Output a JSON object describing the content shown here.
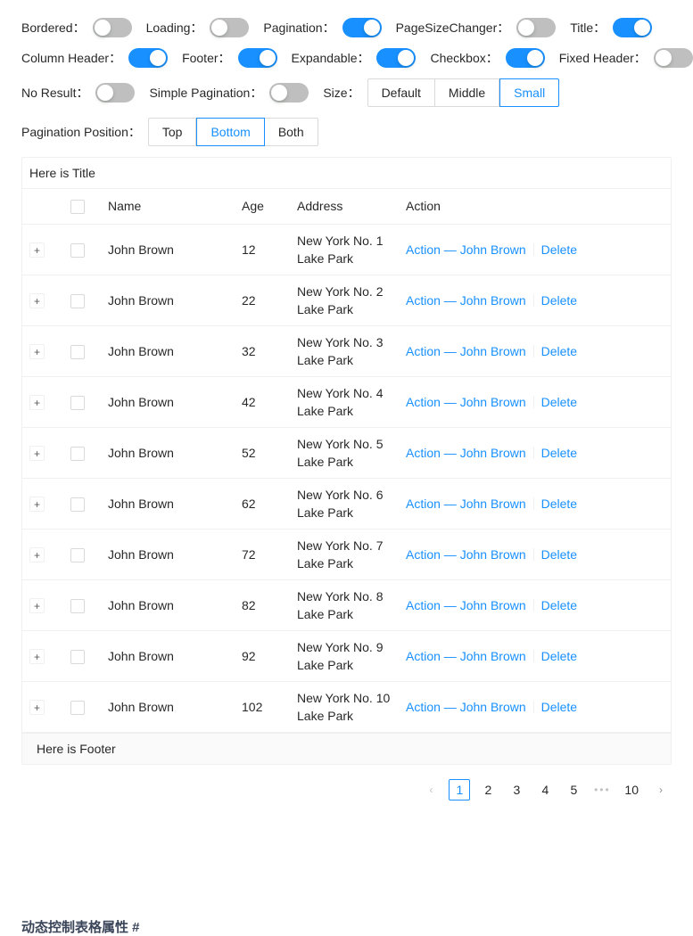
{
  "controls": {
    "rows": [
      [
        {
          "label": "Bordered",
          "type": "switch",
          "on": false,
          "name": "bordered"
        },
        {
          "label": "Loading",
          "type": "switch",
          "on": false,
          "name": "loading"
        },
        {
          "label": "Pagination",
          "type": "switch",
          "on": true,
          "name": "pagination"
        },
        {
          "label": "PageSizeChanger",
          "type": "switch",
          "on": false,
          "name": "page-size-changer"
        },
        {
          "label": "Title",
          "type": "switch",
          "on": true,
          "name": "title"
        }
      ],
      [
        {
          "label": "Column Header",
          "type": "switch",
          "on": true,
          "name": "column-header"
        },
        {
          "label": "Footer",
          "type": "switch",
          "on": true,
          "name": "footer"
        },
        {
          "label": "Expandable",
          "type": "switch",
          "on": true,
          "name": "expandable"
        },
        {
          "label": "Checkbox",
          "type": "switch",
          "on": true,
          "name": "checkbox"
        },
        {
          "label": "Fixed Header",
          "type": "switch",
          "on": false,
          "name": "fixed-header"
        }
      ],
      [
        {
          "label": "No Result",
          "type": "switch",
          "on": false,
          "name": "no-result"
        },
        {
          "label": "Simple Pagination",
          "type": "switch",
          "on": false,
          "name": "simple-pagination"
        },
        {
          "label": "Size",
          "type": "group",
          "name": "size",
          "options": [
            "Default",
            "Middle",
            "Small"
          ],
          "selected": "Small"
        }
      ],
      [
        {
          "label": "Pagination Position",
          "type": "group",
          "name": "pagination-position",
          "options": [
            "Top",
            "Bottom",
            "Both"
          ],
          "selected": "Bottom"
        }
      ]
    ],
    "colon": "："
  },
  "table": {
    "title": "Here is Title",
    "footer": "Here is Footer",
    "columns": [
      "Name",
      "Age",
      "Address",
      "Action"
    ],
    "expand_glyph": "+",
    "action_primary": "Action — John Brown",
    "action_delete": "Delete",
    "rows": [
      {
        "name": "John Brown",
        "age": "12",
        "address": "New York No. 1 Lake Park"
      },
      {
        "name": "John Brown",
        "age": "22",
        "address": "New York No. 2 Lake Park"
      },
      {
        "name": "John Brown",
        "age": "32",
        "address": "New York No. 3 Lake Park"
      },
      {
        "name": "John Brown",
        "age": "42",
        "address": "New York No. 4 Lake Park"
      },
      {
        "name": "John Brown",
        "age": "52",
        "address": "New York No. 5 Lake Park"
      },
      {
        "name": "John Brown",
        "age": "62",
        "address": "New York No. 6 Lake Park"
      },
      {
        "name": "John Brown",
        "age": "72",
        "address": "New York No. 7 Lake Park"
      },
      {
        "name": "John Brown",
        "age": "82",
        "address": "New York No. 8 Lake Park"
      },
      {
        "name": "John Brown",
        "age": "92",
        "address": "New York No. 9 Lake Park"
      },
      {
        "name": "John Brown",
        "age": "102",
        "address": "New York No. 10 Lake Park"
      }
    ]
  },
  "pagination": {
    "prev": "‹",
    "next": "›",
    "ellipsis": "•••",
    "pages": [
      "1",
      "2",
      "3",
      "4",
      "5"
    ],
    "last_page": "10",
    "current": "1"
  },
  "bottom_caption": "动态控制表格属性 #",
  "colors": {
    "accent": "#1890ff",
    "switch_off": "#bfbfbf",
    "border": "#f0f0f0",
    "footer_bg": "#fafafa"
  }
}
